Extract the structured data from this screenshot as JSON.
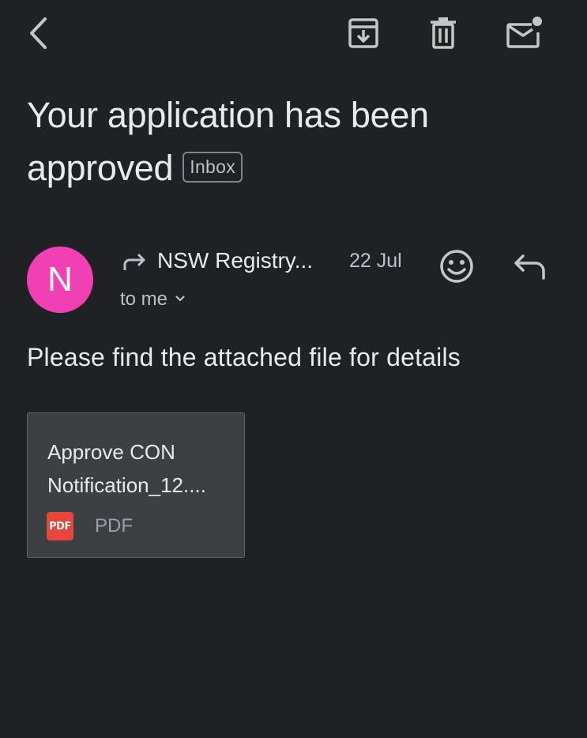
{
  "toolbar": {
    "back_icon": "chevron-left-icon",
    "archive_icon": "archive-icon",
    "delete_icon": "trash-icon",
    "unread_icon": "mark-unread-icon"
  },
  "email": {
    "subject": "Your application has been approved",
    "label": "Inbox",
    "sender": {
      "avatar_letter": "N",
      "avatar_color": "#f040b4",
      "name": "NSW Registry...",
      "forwarded_icon": "forward-arrow-icon"
    },
    "date": "22 Jul",
    "recipients": "to me",
    "body": "Please find the attached file for details",
    "attachment": {
      "name": "Approve CON\nNotification_12....",
      "type": "PDF",
      "icon_text": "PDF",
      "icon_color": "#e8453c"
    }
  },
  "actions": {
    "emoji_icon": "smiley-icon",
    "reply_icon": "reply-icon"
  }
}
